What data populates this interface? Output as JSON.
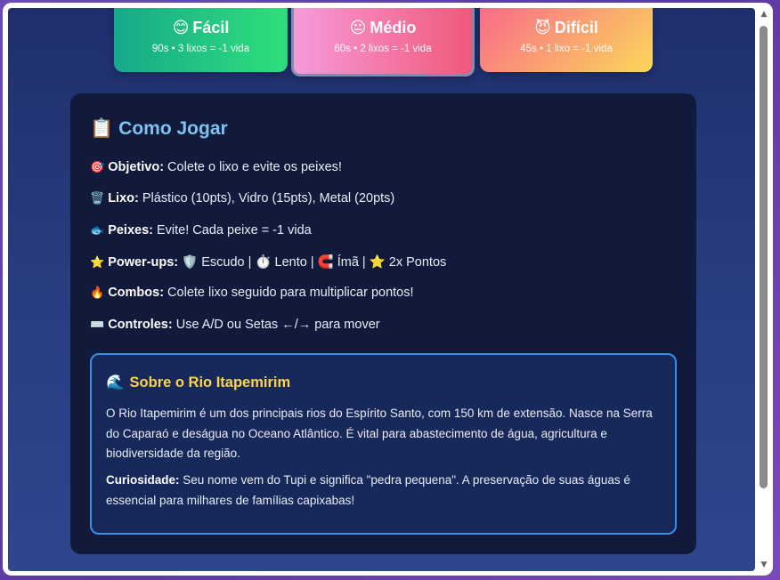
{
  "difficulty": [
    {
      "emoji": "😊",
      "label": "Fácil",
      "desc": "90s • 3 lixos = -1 vida"
    },
    {
      "emoji": "😐",
      "label": "Médio",
      "desc": "60s • 2 lixos = -1 vida"
    },
    {
      "emoji": "😈",
      "label": "Difícil",
      "desc": "45s • 1 lixo = -1 vida"
    }
  ],
  "howto": {
    "emoji": "📋",
    "title": "Como Jogar",
    "rules": [
      {
        "emoji": "🎯",
        "label": "Objetivo:",
        "text": " Colete o lixo e evite os peixes!"
      },
      {
        "emoji": "🗑️",
        "label": "Lixo:",
        "text": " Plástico (10pts), Vidro (15pts), Metal (20pts)"
      },
      {
        "emoji": "🐟",
        "label": "Peixes:",
        "text": " Evite! Cada peixe = -1 vida"
      },
      {
        "emoji": "⭐",
        "label": "Power-ups:",
        "text": " 🛡️ Escudo | ⏱️ Lento | 🧲 Ímã | ⭐ 2x Pontos"
      },
      {
        "emoji": "🔥",
        "label": "Combos:",
        "text": " Colete lixo seguido para multiplicar pontos!"
      },
      {
        "emoji": "⌨️",
        "label": "Controles:",
        "text": " Use A/D ou Setas ←/→ para mover"
      }
    ]
  },
  "about": {
    "emoji": "🌊",
    "title": "Sobre o Rio Itapemirim",
    "text": "O Rio Itapemirim é um dos principais rios do Espírito Santo, com 150 km de extensão. Nasce na Serra do Caparaó e deságua no Oceano Atlântico. É vital para abastecimento de água, agricultura e biodiversidade da região.",
    "curiosity_label": "Curiosidade:",
    "curiosity_text": " Seu nome vem do Tupi e significa \"pedra pequena\". A preservação de suas águas é essencial para milhares de famílias capixabas!"
  },
  "scrollbar": {
    "up": "▲",
    "down": "▼"
  }
}
